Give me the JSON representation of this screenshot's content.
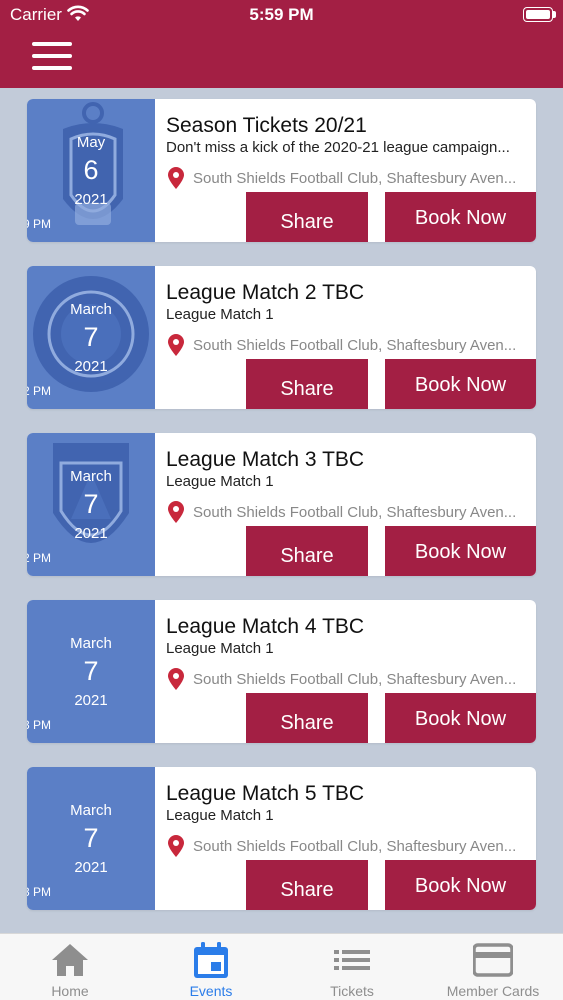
{
  "status_bar": {
    "carrier": "Carrier",
    "time": "5:59 PM"
  },
  "header": {
    "menu_icon": "hamburger-menu-icon",
    "background": "#a31f44"
  },
  "events": [
    {
      "month": "May",
      "day": "6",
      "year": "2021",
      "time": "9 PM",
      "title": "Season Tickets 20/21",
      "subtitle": "Don't miss a kick of the 2020-21 league campaign...",
      "location": "South Shields Football Club, Shaftesbury Aven...",
      "share_label": "Share",
      "book_label": "Book Now",
      "logo": "south-shields-crest-logo"
    },
    {
      "month": "March",
      "day": "7",
      "year": "2021",
      "time": "2 PM",
      "title": "League Match 2 TBC",
      "subtitle": "League Match 1",
      "location": "South Shields Football Club, Shaftesbury Aven...",
      "share_label": "Share",
      "book_label": "Book Now",
      "logo": "buxton-football-club-logo"
    },
    {
      "month": "March",
      "day": "7",
      "year": "2021",
      "time": "2 PM",
      "title": "League Match 3 TBC",
      "subtitle": "League Match 1",
      "location": "South Shields Football Club, Shaftesbury Aven...",
      "share_label": "Share",
      "book_label": "Book Now",
      "logo": "witton-albion-logo"
    },
    {
      "month": "March",
      "day": "7",
      "year": "2021",
      "time": "3 PM",
      "title": "League Match 4 TBC",
      "subtitle": "League Match 1",
      "location": "South Shields Football Club, Shaftesbury Aven...",
      "share_label": "Share",
      "book_label": "Book Now",
      "logo": ""
    },
    {
      "month": "March",
      "day": "7",
      "year": "2021",
      "time": "3 PM",
      "title": "League Match 5 TBC",
      "subtitle": "League Match 1",
      "location": "South Shields Football Club, Shaftesbury Aven...",
      "share_label": "Share",
      "book_label": "Book Now",
      "logo": ""
    }
  ],
  "tabs": [
    {
      "label": "Home",
      "icon": "home-icon",
      "active": false
    },
    {
      "label": "Events",
      "icon": "calendar-icon",
      "active": true
    },
    {
      "label": "Tickets",
      "icon": "list-icon",
      "active": false
    },
    {
      "label": "Member Cards",
      "icon": "credit-card-icon",
      "active": false
    }
  ],
  "colors": {
    "brand": "#a31f44",
    "date_panel": "#5b7fc6",
    "active_tab": "#2b7de9",
    "inactive_tab": "#8e8e8e",
    "location_pin": "#c8283c"
  }
}
